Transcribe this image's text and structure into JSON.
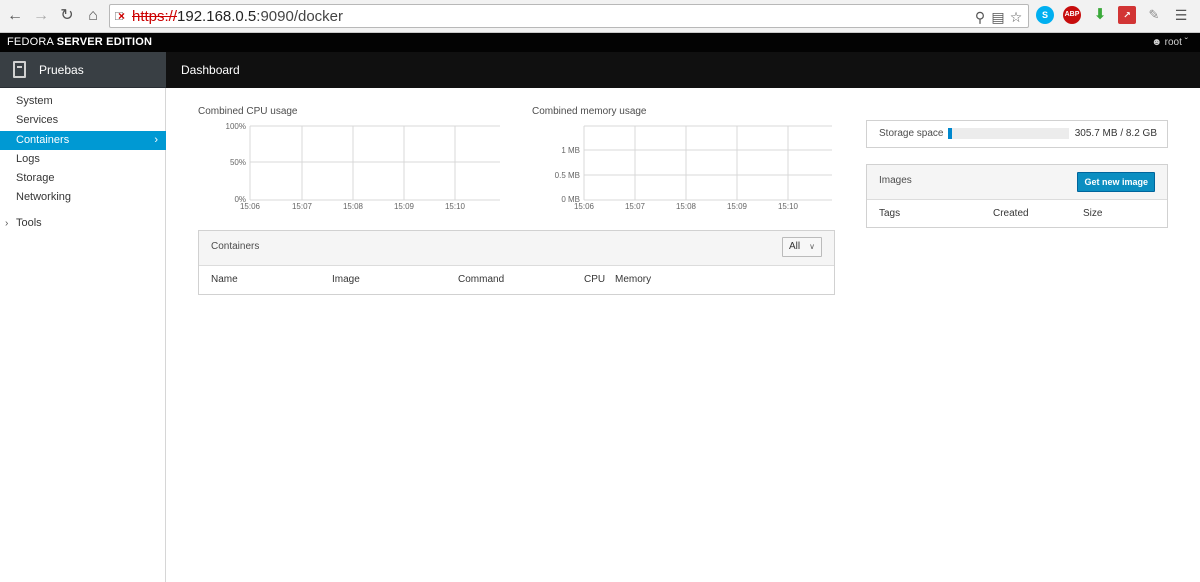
{
  "browser": {
    "url_scheme": "https://",
    "url_host": "192.168.0.5",
    "url_path": ":9090/docker",
    "ext_abp": "ABP"
  },
  "brand": {
    "prefix": "FEDORA ",
    "name": "SERVER EDITION"
  },
  "user": {
    "label": "root"
  },
  "host": {
    "name": "Pruebas"
  },
  "page": {
    "title": "Dashboard"
  },
  "sidebar": {
    "items": [
      {
        "label": "System"
      },
      {
        "label": "Services"
      },
      {
        "label": "Containers"
      },
      {
        "label": "Logs"
      },
      {
        "label": "Storage"
      },
      {
        "label": "Networking"
      }
    ],
    "tools": "Tools"
  },
  "cpu_chart": {
    "title": "Combined CPU usage",
    "y_ticks": [
      "100%",
      "50%",
      "0%"
    ],
    "x_ticks": [
      "15:06",
      "15:07",
      "15:08",
      "15:09",
      "15:10"
    ]
  },
  "mem_chart": {
    "title": "Combined memory usage",
    "y_ticks": [
      "1 MB",
      "0.5 MB",
      "0 MB"
    ],
    "x_ticks": [
      "15:06",
      "15:07",
      "15:08",
      "15:09",
      "15:10"
    ]
  },
  "containers": {
    "title": "Containers",
    "filter": "All",
    "columns": [
      "Name",
      "Image",
      "Command",
      "CPU",
      "Memory"
    ]
  },
  "storage": {
    "label": "Storage space",
    "value": "305.7 MB / 8.2 GB",
    "used_fraction": 0.036
  },
  "images": {
    "title": "Images",
    "button": "Get new image",
    "columns": [
      "Tags",
      "Created",
      "Size"
    ]
  },
  "colors": {
    "accent": "#0099d3",
    "header_dark": "#101010",
    "host_box": "#393f44"
  }
}
